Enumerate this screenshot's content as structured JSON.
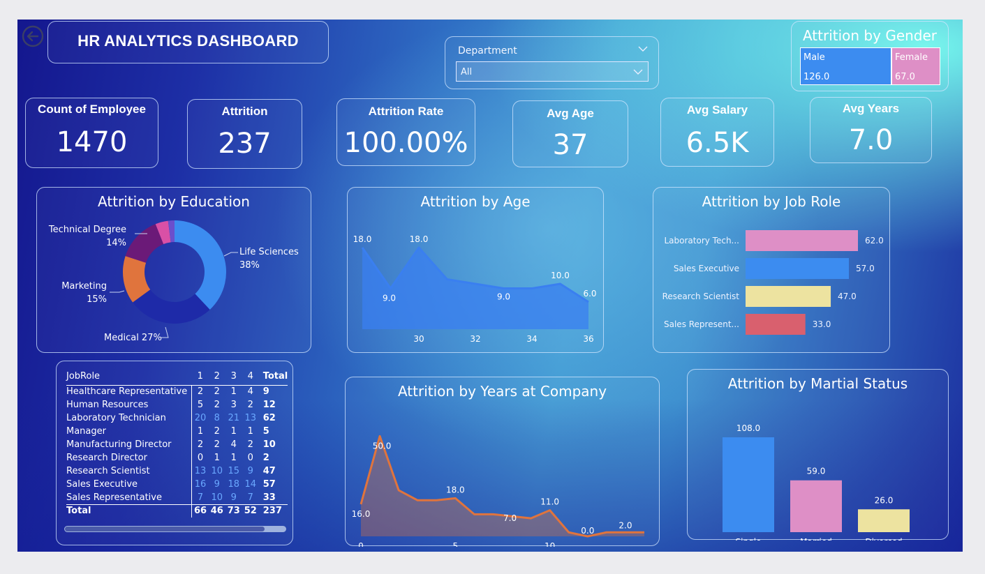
{
  "title": "HR ANALYTICS DASHBOARD",
  "filter": {
    "label": "Department",
    "value": "All"
  },
  "gender": {
    "title": "Attrition by Gender",
    "items": [
      {
        "label": "Male",
        "value": "126.0",
        "color": "#3c8cf0"
      },
      {
        "label": "Female",
        "value": "67.0",
        "color": "#de8fc6"
      }
    ]
  },
  "kpis": [
    {
      "label": "Count of Employee",
      "value": "1470"
    },
    {
      "label": "Attrition",
      "value": "237"
    },
    {
      "label": "Attrition Rate",
      "value": "100.00%"
    },
    {
      "label": "Avg Age",
      "value": "37"
    },
    {
      "label": "Avg Salary",
      "value": "6.5K"
    },
    {
      "label": "Avg Years",
      "value": "7.0"
    }
  ],
  "education": {
    "title": "Attrition by Education",
    "label_life_name": "Life Sciences",
    "label_life_pct": "38%",
    "label_tech_name": "Technical Degree",
    "label_tech_pct": "14%",
    "label_mkt_name": "Marketing",
    "label_mkt_pct": "15%",
    "label_med": "Medical 27%",
    "chart_data": {
      "type": "pie",
      "slices": [
        {
          "name": "Life Sciences",
          "value": 38,
          "color": "#3c8cf0"
        },
        {
          "name": "Medical",
          "value": 27,
          "color": "#1e2aa8"
        },
        {
          "name": "Marketing",
          "value": 15,
          "color": "#e0743d"
        },
        {
          "name": "Technical Degree",
          "value": 14,
          "color": "#6b1a78"
        },
        {
          "name": "Other",
          "value": 4,
          "color": "#d950a6"
        },
        {
          "name": "Human Resources",
          "value": 2,
          "color": "#6b4fcc"
        }
      ]
    }
  },
  "age": {
    "title": "Attrition by Age",
    "chart_data": {
      "type": "area",
      "x": [
        28,
        29,
        30,
        31,
        32,
        33,
        34,
        35,
        36
      ],
      "values": [
        18,
        9,
        18,
        11,
        10,
        9,
        9,
        10,
        6
      ],
      "x_ticks": [
        "30",
        "32",
        "34",
        "36"
      ],
      "labels": [
        {
          "x": 28,
          "text": "18.0"
        },
        {
          "x": 29,
          "text": "9.0"
        },
        {
          "x": 30,
          "text": "18.0"
        },
        {
          "x": 33,
          "text": "9.0"
        },
        {
          "x": 35,
          "text": "10.0"
        },
        {
          "x": 36,
          "text": "6.0"
        }
      ],
      "ylim": [
        0,
        20
      ],
      "color": "#3a7ff0"
    }
  },
  "jobrole": {
    "title": "Attrition by Job Role",
    "chart_data": {
      "type": "bar",
      "categories": [
        "Laboratory Tech...",
        "Sales Executive",
        "Research Scientist",
        "Sales Represent..."
      ],
      "values": [
        62,
        57,
        47,
        33
      ],
      "value_labels": [
        "62.0",
        "57.0",
        "47.0",
        "33.0"
      ],
      "colors": [
        "#de8fc6",
        "#3c8cf0",
        "#ede3a0",
        "#d9606e"
      ],
      "xlim": [
        0,
        62
      ]
    }
  },
  "matrix": {
    "headers": [
      "JobRole",
      "1",
      "2",
      "3",
      "4",
      "Total"
    ],
    "rows": [
      {
        "name": "Healthcare Representative",
        "v": [
          "2",
          "2",
          "1",
          "4"
        ],
        "total": "9",
        "hi": false
      },
      {
        "name": "Human Resources",
        "v": [
          "5",
          "2",
          "3",
          "2"
        ],
        "total": "12",
        "hi": false
      },
      {
        "name": "Laboratory Technician",
        "v": [
          "20",
          "8",
          "21",
          "13"
        ],
        "total": "62",
        "hi": true
      },
      {
        "name": "Manager",
        "v": [
          "1",
          "2",
          "1",
          "1"
        ],
        "total": "5",
        "hi": false
      },
      {
        "name": "Manufacturing Director",
        "v": [
          "2",
          "2",
          "4",
          "2"
        ],
        "total": "10",
        "hi": false
      },
      {
        "name": "Research Director",
        "v": [
          "0",
          "1",
          "1",
          "0"
        ],
        "total": "2",
        "hi": false
      },
      {
        "name": "Research Scientist",
        "v": [
          "13",
          "10",
          "15",
          "9"
        ],
        "total": "47",
        "hi": true
      },
      {
        "name": "Sales Executive",
        "v": [
          "16",
          "9",
          "18",
          "14"
        ],
        "total": "57",
        "hi": true
      },
      {
        "name": "Sales Representative",
        "v": [
          "7",
          "10",
          "9",
          "7"
        ],
        "total": "33",
        "hi": true
      }
    ],
    "total_row": {
      "name": "Total",
      "v": [
        "66",
        "46",
        "73",
        "52"
      ],
      "total": "237"
    }
  },
  "years": {
    "title": "Attrition by Years at Company",
    "chart_data": {
      "type": "area",
      "x": [
        0,
        1,
        2,
        3,
        4,
        5,
        6,
        7,
        8,
        9,
        10,
        11,
        12,
        13,
        14,
        15
      ],
      "values": [
        16,
        50,
        23,
        18,
        18,
        19,
        11,
        11,
        10,
        9,
        13,
        2,
        0,
        2,
        2,
        2
      ],
      "x_ticks": [
        "0",
        "5",
        "10"
      ],
      "labels": [
        {
          "x": 0,
          "text": "16.0"
        },
        {
          "x": 1,
          "text": "50.0"
        },
        {
          "x": 5,
          "text": "18.0"
        },
        {
          "x": 9,
          "text": "7.0"
        },
        {
          "x": 10,
          "text": "11.0"
        },
        {
          "x": 12,
          "text": "0.0"
        },
        {
          "x": 14,
          "text": "2.0"
        }
      ],
      "ylim": [
        0,
        55
      ],
      "color": "#e0743d"
    }
  },
  "marital": {
    "title": "Attrition by Martial Status",
    "chart_data": {
      "type": "bar",
      "categories": [
        "Single",
        "Married",
        "Divorced"
      ],
      "values": [
        108,
        59,
        26
      ],
      "value_labels": [
        "108.0",
        "59.0",
        "26.0"
      ],
      "colors": [
        "#3c8cf0",
        "#de8fc6",
        "#ede3a0"
      ],
      "ylim": [
        0,
        108
      ]
    }
  }
}
